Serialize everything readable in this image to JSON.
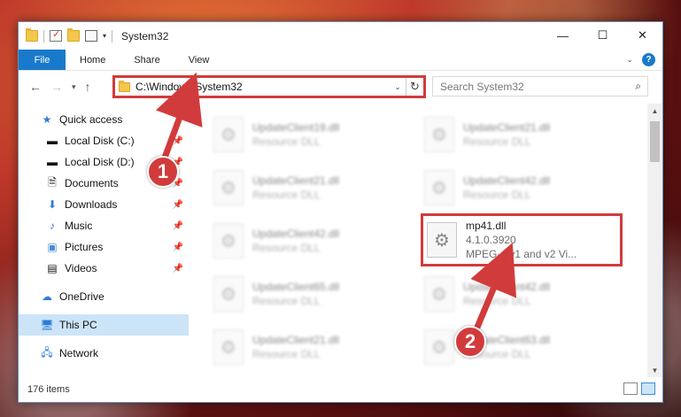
{
  "window": {
    "title": "System32"
  },
  "window_controls": {
    "minimize": "—",
    "maximize": "☐",
    "close": "✕"
  },
  "ribbon": {
    "file": "File",
    "tabs": [
      "Home",
      "Share",
      "View"
    ],
    "help": "?"
  },
  "address": {
    "path": "C:\\Windows\\System32"
  },
  "search": {
    "placeholder": "Search System32"
  },
  "nav": {
    "items": [
      {
        "label": "Quick access",
        "icon": "star-icon"
      },
      {
        "label": "Local Disk (C:)",
        "icon": "drive-icon"
      },
      {
        "label": "Local Disk (D:)",
        "icon": "drive-icon"
      },
      {
        "label": "Documents",
        "icon": "documents-icon"
      },
      {
        "label": "Downloads",
        "icon": "download-icon"
      },
      {
        "label": "Music",
        "icon": "music-icon"
      },
      {
        "label": "Pictures",
        "icon": "pictures-icon"
      },
      {
        "label": "Videos",
        "icon": "videos-icon"
      },
      {
        "label": "OneDrive",
        "icon": "cloud-icon"
      },
      {
        "label": "This PC",
        "icon": "computer-icon"
      },
      {
        "label": "Network",
        "icon": "network-icon"
      }
    ]
  },
  "files": [
    {
      "name": "UpdateClient19.dll",
      "sub": "Resource DLL"
    },
    {
      "name": "UpdateClient21.dll",
      "sub": "Resource DLL"
    },
    {
      "name": "UpdateClient21.dll",
      "sub": "Resource DLL"
    },
    {
      "name": "UpdateClient42.dll",
      "sub": "Resource DLL"
    },
    {
      "name": "UpdateClient42.dll",
      "sub": "Resource DLL"
    },
    {
      "name": "mp41.dll",
      "sub": "4.1.0.3920",
      "sub2": "MPEG-4 v1 and v2 Vi..."
    },
    {
      "name": "UpdateClient65.dll",
      "sub": "Resource DLL"
    },
    {
      "name": "UpdateClient42.dll",
      "sub": "Resource DLL"
    },
    {
      "name": "UpdateClient21.dll",
      "sub": "Resource DLL"
    },
    {
      "name": "UpdateClient63.dll",
      "sub": "Resource DLL"
    }
  ],
  "status": {
    "count": "176 items"
  },
  "callouts": {
    "one": "1",
    "two": "2"
  },
  "colors": {
    "accent": "#1979ca",
    "highlight": "#d23b3b"
  }
}
